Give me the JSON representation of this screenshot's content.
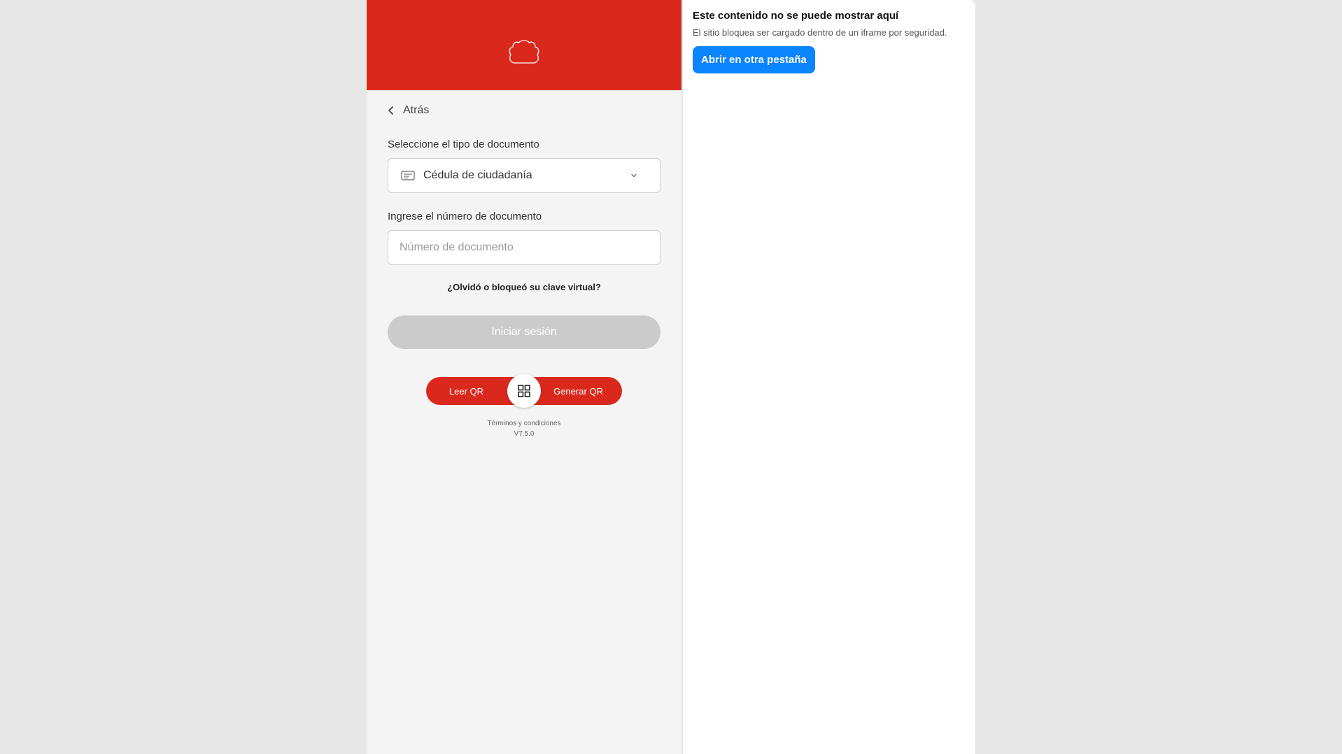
{
  "login": {
    "back_label": "Atrás",
    "doc_type_label": "Seleccione el tipo de documento",
    "doc_type_selected": "Cédula de ciudadanía",
    "doc_number_label": "Ingrese el número de documento",
    "doc_number_placeholder": "Número de documento",
    "forgot_label": "¿Olvidó o bloqueó su clave virtual?",
    "login_button_label": "Iniciar sesión",
    "qr_read_label": "Leer QR",
    "qr_generate_label": "Generar QR",
    "terms_label": "Términos y condiciones",
    "version": "V7.5.0"
  },
  "frame_notice": {
    "title": "Este contenido no se puede mostrar aquí",
    "message": "El sitio bloquea ser cargado dentro de un iframe por seguridad.",
    "open_tab_label": "Abrir en otra pestaña"
  },
  "colors": {
    "brand_red": "#da291c",
    "panel_bg": "#f4f4f4",
    "disabled_button": "#cbcbcb",
    "link_blue": "#0a84ff"
  },
  "icons": {
    "logo": "bank-logo-icon",
    "back": "chevron-left-icon",
    "doc": "id-card-icon",
    "dropdown": "chevron-down-icon",
    "qr": "qr-grid-icon"
  }
}
